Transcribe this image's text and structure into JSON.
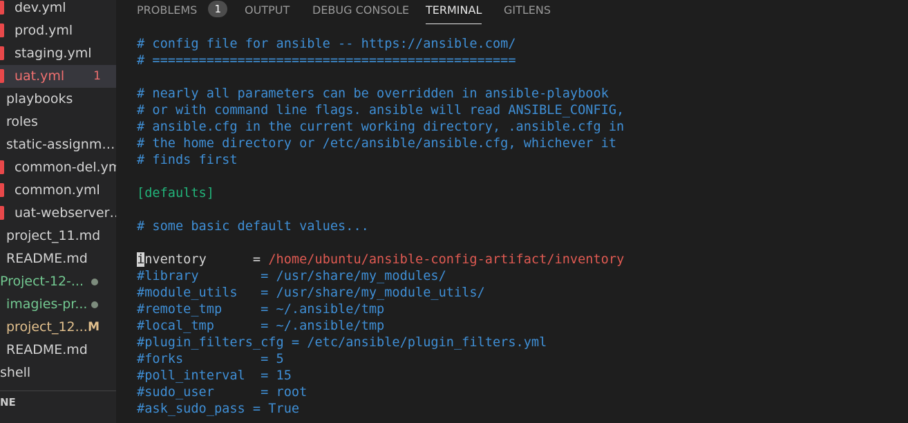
{
  "sidebar": {
    "items": [
      {
        "label": "dev.yml",
        "kind": "file",
        "color": "#d4d4d4"
      },
      {
        "label": "prod.yml",
        "kind": "file",
        "color": "#d4d4d4"
      },
      {
        "label": "staging.yml",
        "kind": "file",
        "color": "#d4d4d4"
      },
      {
        "label": "uat.yml",
        "kind": "file",
        "color": "#f07070",
        "badge": "1",
        "selected": true
      },
      {
        "label": "playbooks",
        "kind": "folder",
        "color": "#d4d4d4"
      },
      {
        "label": "roles",
        "kind": "folder",
        "color": "#d4d4d4"
      },
      {
        "label": "static-assignmen...",
        "kind": "folder",
        "color": "#d4d4d4"
      },
      {
        "label": "common-del.yml",
        "kind": "file",
        "color": "#d4d4d4"
      },
      {
        "label": "common.yml",
        "kind": "file",
        "color": "#d4d4d4"
      },
      {
        "label": "uat-webservers....",
        "kind": "file",
        "color": "#d4d4d4"
      },
      {
        "label": "project_11.md",
        "kind": "plain",
        "color": "#d4d4d4"
      },
      {
        "label": "README.md",
        "kind": "plain",
        "color": "#d4d4d4"
      },
      {
        "label": "Project-12-...",
        "kind": "folder-untracked",
        "color": "#73c991",
        "git": "dot"
      },
      {
        "label": "imagies-pr...",
        "kind": "untracked",
        "color": "#73c991",
        "git": "dot"
      },
      {
        "label": "project_12....",
        "kind": "modified",
        "color": "#e2c08d",
        "git": "M"
      },
      {
        "label": "README.md",
        "kind": "plain",
        "color": "#d4d4d4"
      },
      {
        "label": "shell",
        "kind": "folder",
        "color": "#d4d4d4"
      }
    ],
    "section_label": "NE"
  },
  "panel": {
    "tabs": [
      {
        "label": "PROBLEMS",
        "badge": "1"
      },
      {
        "label": "OUTPUT"
      },
      {
        "label": "DEBUG CONSOLE"
      },
      {
        "label": "TERMINAL",
        "active": true
      },
      {
        "label": "GITLENS"
      }
    ]
  },
  "terminal": {
    "lines": [
      {
        "text": "# config file for ansible -- https://ansible.com/",
        "style": "comment"
      },
      {
        "text": "# ===============================================",
        "style": "comment"
      },
      {
        "text": "",
        "style": "blank"
      },
      {
        "text": "# nearly all parameters can be overridden in ansible-playbook",
        "style": "comment"
      },
      {
        "text": "# or with command line flags. ansible will read ANSIBLE_CONFIG,",
        "style": "comment"
      },
      {
        "text": "# ansible.cfg in the current working directory, .ansible.cfg in",
        "style": "comment"
      },
      {
        "text": "# the home directory or /etc/ansible/ansible.cfg, whichever it",
        "style": "comment"
      },
      {
        "text": "# finds first",
        "style": "comment"
      },
      {
        "text": "",
        "style": "blank"
      },
      {
        "text": "[defaults]",
        "style": "section"
      },
      {
        "text": "",
        "style": "blank"
      },
      {
        "text": "# some basic default values...",
        "style": "comment"
      },
      {
        "text": "",
        "style": "blank"
      },
      {
        "cursor_char": "i",
        "key": "nventory      = ",
        "value": "/home/ubuntu/ansible-config-artifact/inventory",
        "style": "keyvalue"
      },
      {
        "text": "#library        = /usr/share/my_modules/",
        "style": "comment"
      },
      {
        "text": "#module_utils   = /usr/share/my_module_utils/",
        "style": "comment"
      },
      {
        "text": "#remote_tmp     = ~/.ansible/tmp",
        "style": "comment"
      },
      {
        "text": "#local_tmp      = ~/.ansible/tmp",
        "style": "comment"
      },
      {
        "text": "#plugin_filters_cfg = /etc/ansible/plugin_filters.yml",
        "style": "comment"
      },
      {
        "text": "#forks          = 5",
        "style": "comment"
      },
      {
        "text": "#poll_interval  = 15",
        "style": "comment"
      },
      {
        "text": "#sudo_user      = root",
        "style": "comment"
      },
      {
        "text": "#ask_sudo_pass = True",
        "style": "comment"
      }
    ]
  },
  "colors": {
    "comment": "#3f8fd6",
    "section": "#22b47a",
    "path": "#e05a52",
    "error_file": "#e8484a"
  }
}
